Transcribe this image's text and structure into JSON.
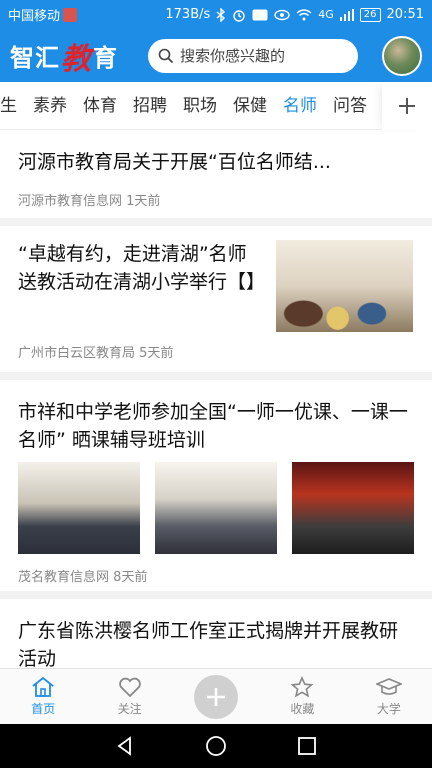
{
  "status_bar": {
    "carrier": "中国移动",
    "network_speed": "173B/s",
    "signal_text": "4G",
    "battery": "26",
    "time": "20:51"
  },
  "header": {
    "logo_part1": "智汇",
    "logo_accent": "教",
    "logo_part2": "育",
    "search_placeholder": "搜索你感兴趣的"
  },
  "tabs": {
    "items": [
      "生",
      "素养",
      "体育",
      "招聘",
      "职场",
      "保健",
      "名师",
      "问答"
    ],
    "active_index": 6,
    "active_color": "#1e8de6"
  },
  "feed": {
    "articles": [
      {
        "title": "河源市教育局关于开展“百位名师结...",
        "source": "河源市教育信息网",
        "time": "1天前"
      },
      {
        "title": "“卓越有约，走进清湖”名师送教活动在清湖小学举行【】",
        "source": "广州市白云区教育局",
        "time": "5天前"
      },
      {
        "title": "市祥和中学老师参加全国“一师一优课、一课一名师” 晒课辅导班培训",
        "source": "茂名教育信息网",
        "time": "8天前"
      },
      {
        "title": "广东省陈洪樱名师工作室正式揭牌并开展教研活动",
        "source": "",
        "time": ""
      }
    ]
  },
  "bottom_nav": {
    "home": "首页",
    "follow": "关注",
    "favorites": "收藏",
    "university": "大学"
  },
  "colors": {
    "brand": "#1e8de6",
    "logo_accent": "#e0232b"
  }
}
